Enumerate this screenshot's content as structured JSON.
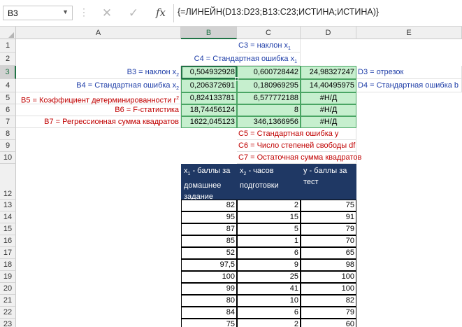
{
  "formula_bar": {
    "name_box": "B3",
    "formula": "{=ЛИНЕЙН(D13:D23;B13:C23;ИСТИНА;ИСТИНА)}"
  },
  "columns": [
    "A",
    "B",
    "C",
    "D",
    "E"
  ],
  "rows": [
    "1",
    "2",
    "3",
    "4",
    "5",
    "6",
    "7",
    "8",
    "9",
    "10",
    "12",
    "13",
    "14",
    "15",
    "16",
    "17",
    "18",
    "19",
    "20",
    "21",
    "22",
    "23"
  ],
  "labels": {
    "c1": "С3 = наклон x",
    "c1_sub": "1",
    "c2": "С4 = Стандартная ошибка x",
    "c2_sub": "1",
    "a3": "В3 = наклон x",
    "a3_sub": "2",
    "a4": "В4 = Стандартная ошибка x",
    "a4_sub": "2",
    "a5": "В5 = Коэффициент детерминированности r",
    "a5_sup": "2",
    "a6": "В6 = F-статистика",
    "a7": "В7 = Регрессионная сумма квадратов",
    "e3": "D3 = отрезок",
    "e4": "D4 = Стандартная ошибка b",
    "c8": "С5 = Стандартная ошибка y",
    "c9": "С6 = Число степеней свободы df",
    "c10": "С7 = Остаточная сумма квадратов"
  },
  "results": [
    [
      "0,504932928",
      "0,600728442",
      "24,98327247"
    ],
    [
      "0,206372691",
      "0,180969295",
      "14,40495975"
    ],
    [
      "0,824133781",
      "6,577772188",
      "#Н/Д"
    ],
    [
      "18,74456124",
      "8",
      "#Н/Д"
    ],
    [
      "1622,045123",
      "346,1366956",
      "#Н/Д"
    ]
  ],
  "table_headers": {
    "b_main": "x",
    "b_sub": "1",
    "b_rest": " - баллы за домашнее задание",
    "c_main": "x",
    "c_sub": "2",
    "c_rest": " - часов подготовки",
    "d": "y - баллы за тест"
  },
  "table_rows": [
    [
      "82",
      "2",
      "75"
    ],
    [
      "95",
      "15",
      "91"
    ],
    [
      "87",
      "5",
      "79"
    ],
    [
      "85",
      "1",
      "70"
    ],
    [
      "52",
      "6",
      "65"
    ],
    [
      "97,5",
      "9",
      "98"
    ],
    [
      "100",
      "25",
      "100"
    ],
    [
      "99",
      "41",
      "100"
    ],
    [
      "80",
      "10",
      "82"
    ],
    [
      "84",
      "6",
      "79"
    ],
    [
      "75",
      "2",
      "60"
    ]
  ],
  "colors": {
    "accent": "#217346",
    "result_fill": "#c6efce",
    "header_fill": "#1f3864",
    "blue_text": "#1f3ea8",
    "red_text": "#c00000"
  },
  "icons": [
    "cancel-icon",
    "check-icon",
    "fx-icon",
    "dropdown-icon"
  ]
}
